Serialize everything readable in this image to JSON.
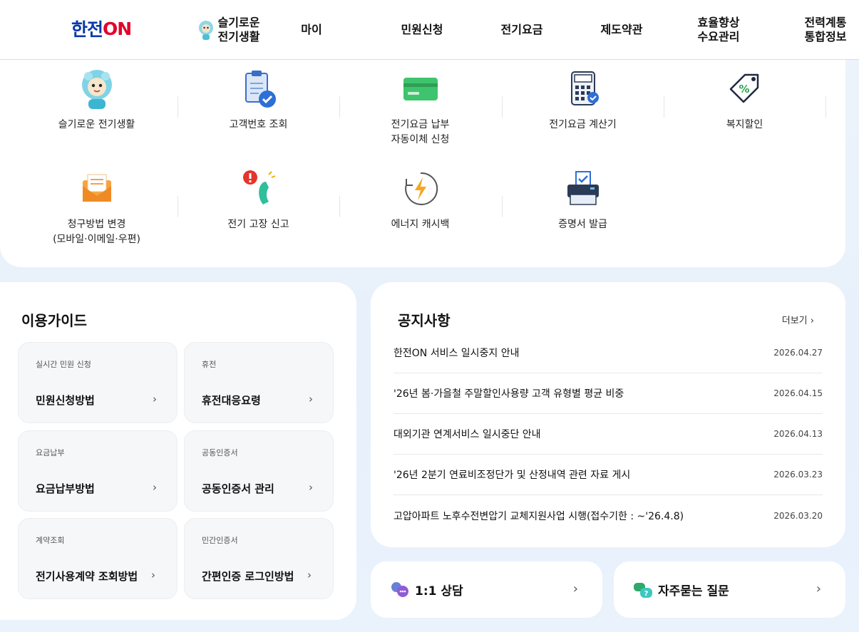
{
  "header": {
    "logo_main": "한전",
    "logo_on": "ON",
    "nav": [
      {
        "line1": "슬기로운",
        "line2": "전기생활"
      },
      {
        "line1": "마이",
        "line2": ""
      },
      {
        "line1": "민원신청",
        "line2": ""
      },
      {
        "line1": "전기요금",
        "line2": ""
      },
      {
        "line1": "제도약관",
        "line2": ""
      },
      {
        "line1": "효율향상",
        "line2": "수요관리"
      },
      {
        "line1": "전력계통",
        "line2": "통합정보"
      }
    ]
  },
  "services": [
    {
      "label": "슬기로운 전기생활",
      "icon": "mascot-icon"
    },
    {
      "label": "고객번호 조회",
      "icon": "clipboard-check-icon"
    },
    {
      "label": "전기요금 납부\n자동이체 신청",
      "icon": "credit-card-icon"
    },
    {
      "label": "전기요금 계산기",
      "icon": "calculator-icon"
    },
    {
      "label": "복지할인",
      "icon": "discount-tag-icon"
    },
    {
      "label": "청구방법 변경\n(모바일·이메일·우편)",
      "icon": "mail-icon"
    },
    {
      "label": "전기 고장 신고",
      "icon": "phone-alert-icon"
    },
    {
      "label": "에너지 캐시백",
      "icon": "energy-cashback-icon"
    },
    {
      "label": "증명서 발급",
      "icon": "printer-icon"
    }
  ],
  "guide": {
    "title": "이용가이드",
    "tiles": [
      {
        "category": "실시간 민원 신청",
        "name": "민원신청방법"
      },
      {
        "category": "휴전",
        "name": "휴전대응요령"
      },
      {
        "category": "요금납부",
        "name": "요금납부방법"
      },
      {
        "category": "공동인증서",
        "name": "공동인증서 관리"
      },
      {
        "category": "계약조회",
        "name": "전기사용계약 조회방법"
      },
      {
        "category": "민간인증서",
        "name": "간편인증 로그인방법"
      }
    ]
  },
  "notices": {
    "title": "공지사항",
    "more_label": "더보기",
    "items": [
      {
        "title": "한전ON 서비스 일시중지 안내",
        "date": "2026.04.27"
      },
      {
        "title": "'26년 봄·가을철 주말할인사용량 고객 유형별 평균 비중",
        "date": "2026.04.15"
      },
      {
        "title": "대외기관 연계서비스 일시중단 안내",
        "date": "2026.04.13"
      },
      {
        "title": "'26년 2분기 연료비조정단가 및 산정내역 관련 자료 게시",
        "date": "2026.03.23"
      },
      {
        "title": "고압아파트 노후수전변압기 교체지원사업 시행(접수기한 : ~'26.4.8)",
        "date": "2026.03.20"
      }
    ]
  },
  "quick": [
    {
      "label": "1:1 상담",
      "icon": "consult-chat-icon"
    },
    {
      "label": "자주묻는 질문",
      "icon": "faq-chat-icon"
    }
  ],
  "colors": {
    "brand_blue": "#0a3aa8",
    "brand_red": "#e4002b",
    "background": "#e9f1fb"
  }
}
